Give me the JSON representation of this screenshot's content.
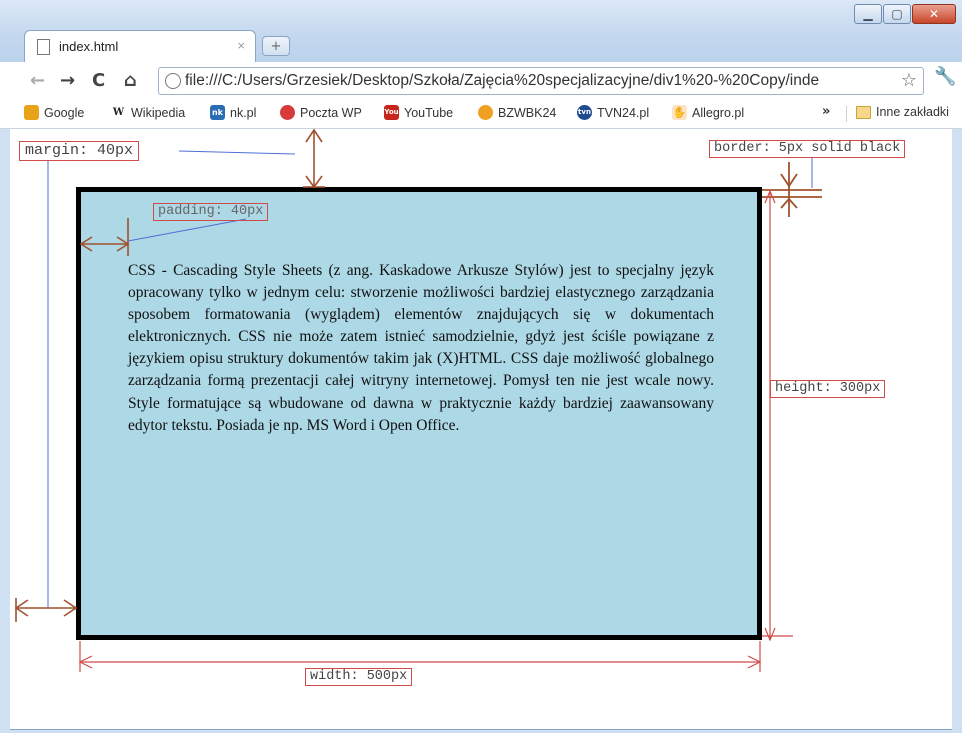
{
  "window": {
    "controls": {
      "minimize": "▁",
      "maximize": "▢",
      "close": "✕"
    }
  },
  "tab": {
    "title": "index.html",
    "close": "×",
    "new_tab": "+"
  },
  "toolbar": {
    "back": "←",
    "forward": "→",
    "reload": "C",
    "home": "⌂",
    "url": "file:///C:/Users/Grzesiek/Desktop/Szkoła/Zajęcia%20specjalizacyjne/div1%20-%20Copy/inde",
    "star": "☆",
    "wrench": "🔧"
  },
  "bookmarks": {
    "items": [
      {
        "label": "Google",
        "icon": "google-icon",
        "color": "#e8a31b"
      },
      {
        "label": "Wikipedia",
        "icon": "wikipedia-icon",
        "color": "#444444"
      },
      {
        "label": "nk.pl",
        "icon": "nk-icon",
        "color": "#2a6db5"
      },
      {
        "label": "Poczta WP",
        "icon": "poczta-wp-icon",
        "color": "#d63a3a"
      },
      {
        "label": "YouTube",
        "icon": "youtube-icon",
        "color": "#c8261d"
      },
      {
        "label": "BZWBK24",
        "icon": "bzwbk-icon",
        "color": "#f0a020"
      },
      {
        "label": "TVN24.pl",
        "icon": "tvn24-icon",
        "color": "#1f4d8f"
      },
      {
        "label": "Allegro.pl",
        "icon": "allegro-icon",
        "color": "#f07f1a"
      }
    ],
    "more": "»",
    "other": "Inne zakładki"
  },
  "demo": {
    "text": "CSS - Cascading Style Sheets (z ang. Kaskadowe Arkusze Stylów) jest to specjalny język opracowany tylko w jednym celu: stworzenie możliwości bardziej elastycznego zarządzania sposobem formatowania (wyglądem) elementów znajdujących się w dokumentach elektronicznych. CSS nie może zatem istnieć samodzielnie, gdyż jest ściśle powiązane z językiem opisu struktury dokumentów takim jak (X)HTML. CSS daje możliwość globalnego zarządzania formą prezentacji całej witryny internetowej. Pomysł ten nie jest wcale nowy. Style formatujące są wbudowane od dawna w praktycznie każdy bardziej zaawansowany edytor tekstu. Posiada je np. MS Word i Open Office.",
    "labels": {
      "margin": "margin: 40px",
      "border": "border: 5px solid black",
      "padding": "padding: 40px",
      "height": "height: 300px",
      "width": "width: 500px"
    },
    "box_background": "#add8e6",
    "arrow_color": "#a0522d",
    "dimension_color": "#d24b4b",
    "leader_color": "#4f6fd8"
  }
}
